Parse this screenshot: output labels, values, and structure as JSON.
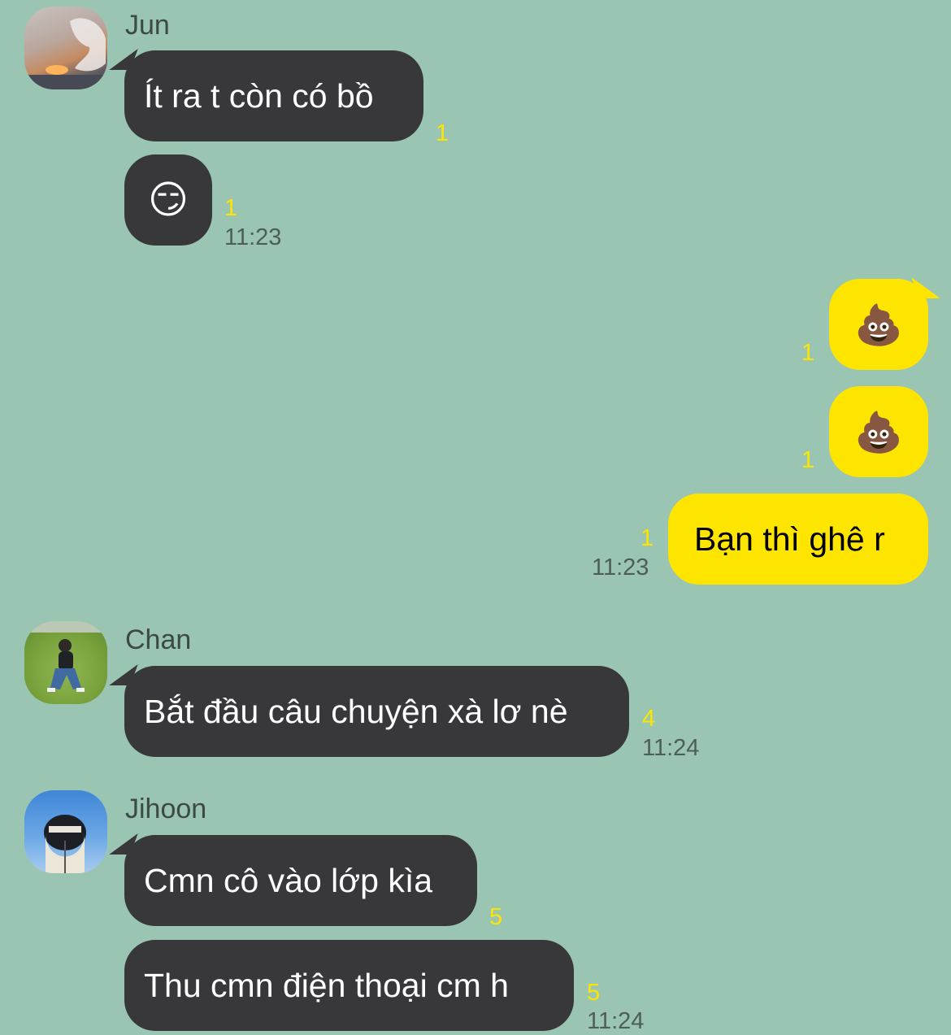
{
  "colors": {
    "background": "#9bc5b3",
    "incoming_bubble": "#38383b",
    "outgoing_bubble": "#fee500",
    "unread": "#fee500"
  },
  "messages": [
    {
      "sender": "Jun",
      "avatar": "sunset-hand-photo",
      "bubbles": [
        {
          "text": "Ít ra t còn có bồ",
          "unread": "1"
        },
        {
          "text": "😏",
          "unread": "1",
          "time": "11:23"
        }
      ]
    },
    {
      "sender": "me",
      "bubbles": [
        {
          "text": "💩",
          "unread": "1"
        },
        {
          "text": "💩",
          "unread": "1"
        },
        {
          "text": "Bạn thì ghê r",
          "unread": "1",
          "time": "11:23"
        }
      ]
    },
    {
      "sender": "Chan",
      "avatar": "person-on-grass-photo",
      "bubbles": [
        {
          "text": "Bắt đầu câu chuyện xà lơ nè",
          "unread": "4",
          "time": "11:24"
        }
      ]
    },
    {
      "sender": "Jihoon",
      "avatar": "masked-person-sky-photo",
      "bubbles": [
        {
          "text": "Cmn cô vào lớp kìa",
          "unread": "5"
        },
        {
          "text": "Thu cmn điện thoại cm h",
          "unread": "5",
          "time": "11:24"
        }
      ]
    }
  ]
}
